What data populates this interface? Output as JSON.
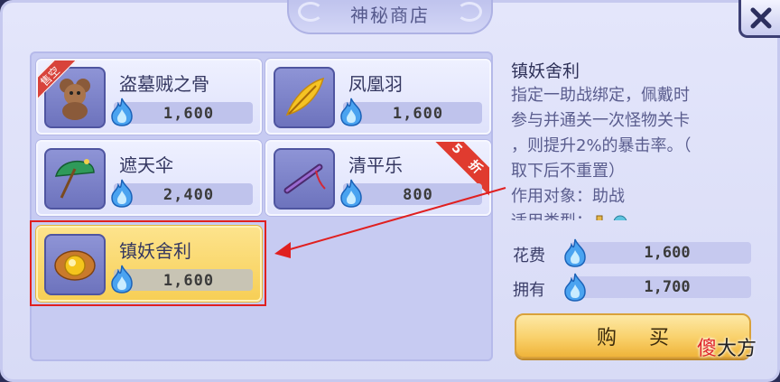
{
  "window": {
    "title": "神秘商店"
  },
  "currency_icon": "blue-flame-crystal",
  "items": [
    {
      "name": "盗墓贼之骨",
      "price": "1,600",
      "icon": "teddy-bear-icon",
      "badge": "售空"
    },
    {
      "name": "凤凰羽",
      "price": "1,600",
      "icon": "phoenix-feather-icon",
      "badge": ""
    },
    {
      "name": "遮天伞",
      "price": "2,400",
      "icon": "umbrella-icon",
      "badge": ""
    },
    {
      "name": "清平乐",
      "price": "800",
      "icon": "flute-icon",
      "badge": "5 折"
    },
    {
      "name": "镇妖舍利",
      "price": "1,600",
      "icon": "relic-orb-icon",
      "badge": ""
    }
  ],
  "selected_index": 4,
  "detail": {
    "title": "镇妖舍利",
    "line1": "指定一助战绑定，佩戴时",
    "line2": "参与并通关一次怪物关卡",
    "line3": "，则提升2%的暴击率。（",
    "line4": "取下后不重置）",
    "target": "作用对象：助战",
    "type_label": "适用类型："
  },
  "cost": {
    "label": "花费",
    "value": "1,600"
  },
  "owned": {
    "label": "拥有",
    "value": "1,700"
  },
  "buy_button": "购买",
  "watermark": {
    "accent": "傻",
    "rest": "大方"
  },
  "colors": {
    "highlight": "#e02020",
    "selected_card": "#f7cf56",
    "sale_ribbon": "#e03b2f"
  }
}
